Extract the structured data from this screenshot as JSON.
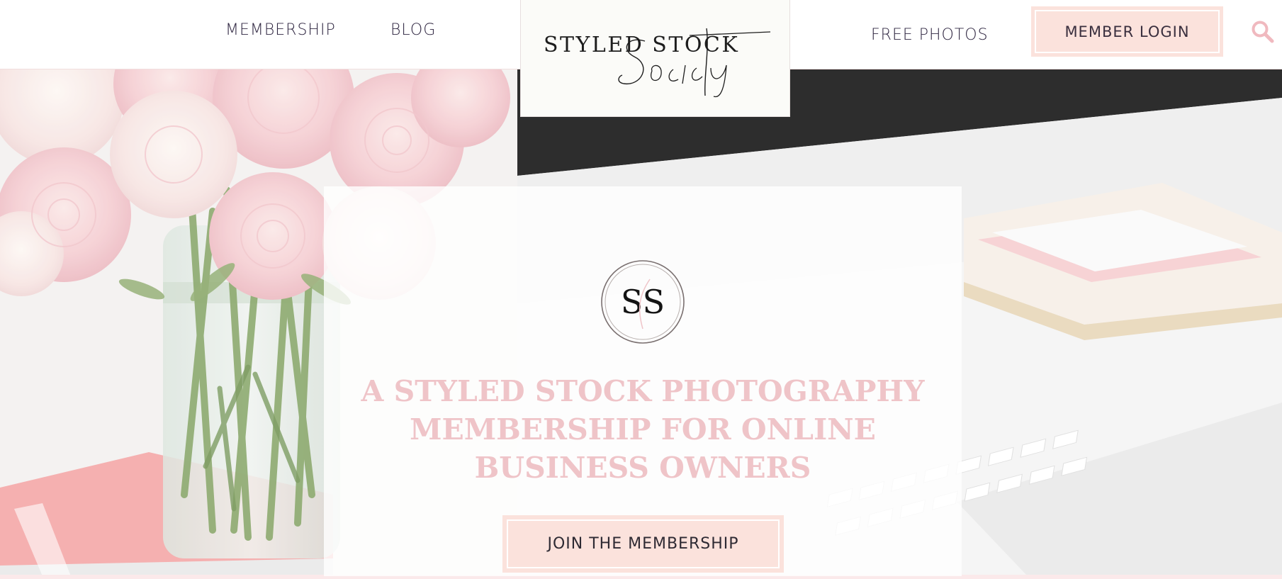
{
  "header": {
    "nav_left": [
      {
        "label": "MEMBERSHIP"
      },
      {
        "label": "BLOG"
      }
    ],
    "logo": {
      "wordmark": "STYLED STOCK",
      "script": "Society"
    },
    "nav_right": {
      "label": "FREE PHOTOS"
    },
    "login_label": "MEMBER LOGIN",
    "search_icon": "search-icon"
  },
  "hero": {
    "badge": {
      "monogram": "SS"
    },
    "title_lines": [
      "A STYLED STOCK PHOTOGRAPHY",
      "MEMBERSHIP FOR ONLINE",
      "BUSINESS OWNERS"
    ],
    "cta_label": "JOIN THE MEMBERSHIP"
  },
  "colors": {
    "accent_pink": "#fbe2dc",
    "title_pink": "#efc4c8",
    "text_dark": "#2e2540"
  }
}
